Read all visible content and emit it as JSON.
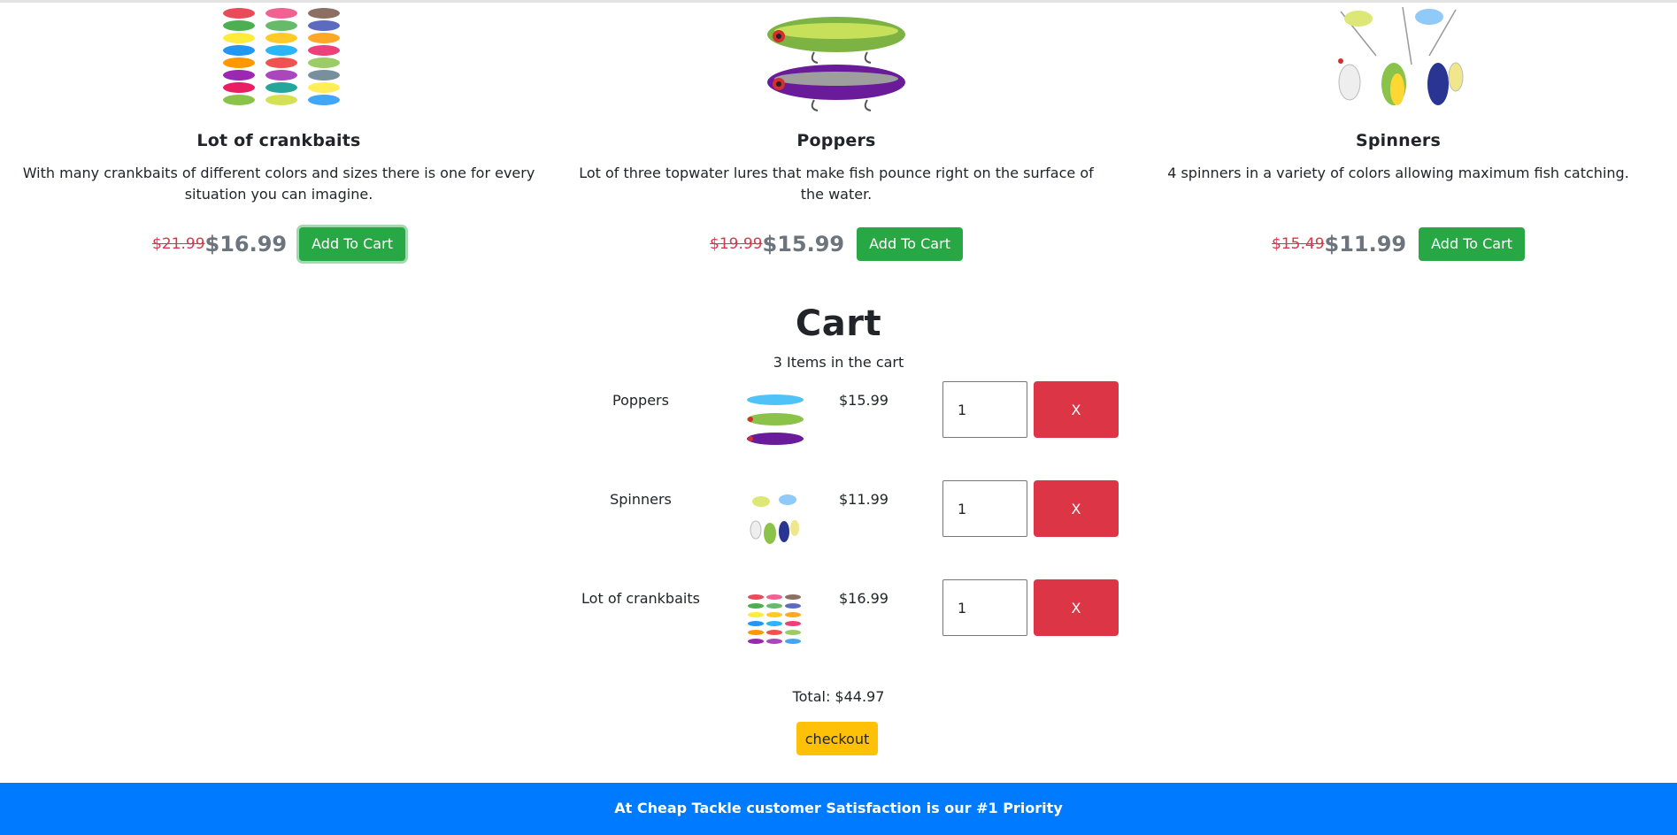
{
  "products": [
    {
      "name": "Lot of crankbaits",
      "description": "With many crankbaits of different colors and sizes there is one for every situation you can imagine.",
      "old_price": "$21.99 ",
      "price": "$16.99",
      "button": "Add To Cart"
    },
    {
      "name": "Poppers",
      "description": "Lot of three topwater lures that make fish pounce right on the surface of the water.",
      "old_price": "$19.99 ",
      "price": "$15.99",
      "button": "Add To Cart"
    },
    {
      "name": "Spinners",
      "description": "4 spinners in a variety of colors allowing maximum fish catching.",
      "old_price": "$15.49 ",
      "price": "$11.99",
      "button": "Add To Cart"
    }
  ],
  "cart": {
    "title": "Cart",
    "count_text": "3 Items in the cart",
    "items": [
      {
        "name": "Poppers",
        "price": "$15.99",
        "qty": "1",
        "remove": "X"
      },
      {
        "name": "Spinners",
        "price": "$11.99",
        "qty": "1",
        "remove": "X"
      },
      {
        "name": "Lot of crankbaits",
        "price": "$16.99",
        "qty": "1",
        "remove": "X"
      }
    ],
    "total": "Total: $44.97",
    "checkout": "checkout"
  },
  "footer": {
    "text": "At Cheap Tackle customer Satisfaction is our #1 Priority"
  },
  "colors": {
    "add_button": "#28a745",
    "remove_button": "#dc3545",
    "checkout_button": "#ffc107",
    "footer_bg": "#007bff",
    "old_price": "#dc3545",
    "new_price": "#6c757d"
  }
}
